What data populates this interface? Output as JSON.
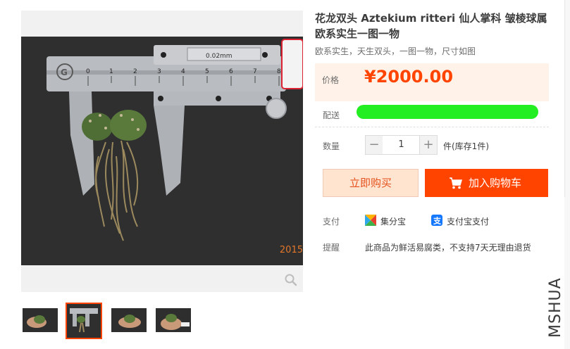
{
  "product": {
    "title": "花龙双头 Aztekium ritteri 仙人掌科 皱棱球属 欧系实生一图一物",
    "subtitle": "欧系实生，天生双头，一图一物，尺寸如图"
  },
  "price": {
    "label": "价格",
    "value": "¥2000.00"
  },
  "shipping": {
    "label": "配送"
  },
  "quantity": {
    "label": "数量",
    "minus": "−",
    "value": "1",
    "plus": "+",
    "unit_text": "件(库存1件)"
  },
  "actions": {
    "buy_now": "立即购买",
    "add_to_cart": "加入购物车"
  },
  "payment": {
    "label": "支付",
    "methods": [
      {
        "name": "集分宝",
        "icon": "jifenbao-icon"
      },
      {
        "name": "支付宝支付",
        "icon": "alipay-icon"
      }
    ]
  },
  "reminder": {
    "label": "提醒",
    "text": "此商品为鲜活易腐类，不支持7天无理由退货"
  },
  "image": {
    "caliper_reading": "0.02mm",
    "year_stamp": "2015"
  },
  "watermark": "MSHUA",
  "colors": {
    "accent": "#ff4400",
    "price_bg": "#fff2e8",
    "buy_now_bg": "#ffe4d0",
    "shipping_redaction": "#22ee22"
  }
}
